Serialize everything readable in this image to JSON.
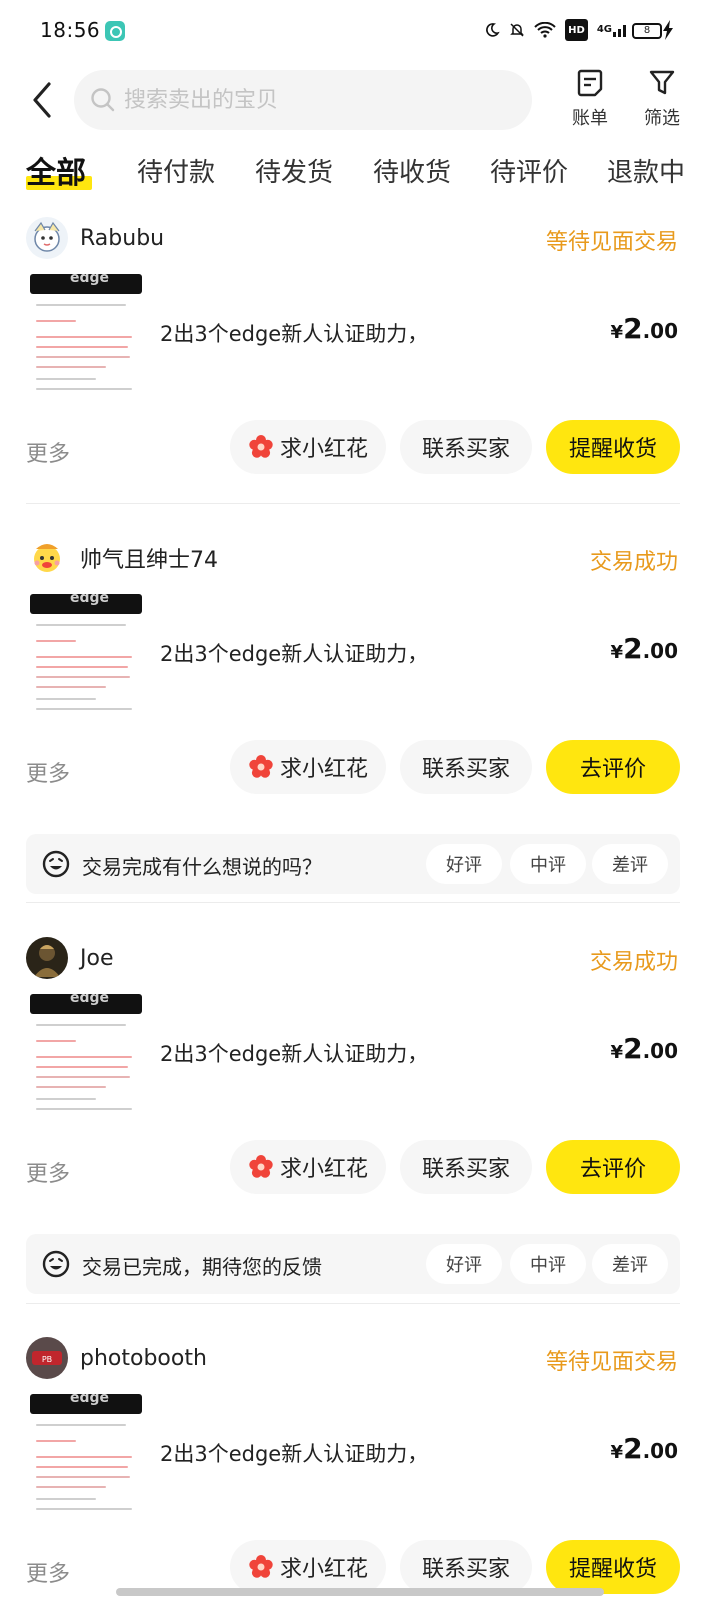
{
  "status_bar": {
    "time": "18:56",
    "battery": "8",
    "network": "4G",
    "hd": "HD"
  },
  "header": {
    "search_placeholder": "搜索卖出的宝贝",
    "bill_label": "账单",
    "filter_label": "筛选"
  },
  "tabs": [
    "全部",
    "待付款",
    "待发货",
    "待收货",
    "待评价",
    "退款中"
  ],
  "orders": [
    {
      "seller": "Rabubu",
      "status": "等待见面交易",
      "title": "2出3个edge新人认证助力，",
      "price_currency": "¥",
      "price_int": "2",
      "price_dec": ".00",
      "more": "更多",
      "flower_btn": "求小红花",
      "contact_btn": "联系买家",
      "main_btn": "提醒收货"
    },
    {
      "seller": "帅气且绅士74",
      "status": "交易成功",
      "title": "2出3个edge新人认证助力，",
      "price_currency": "¥",
      "price_int": "2",
      "price_dec": ".00",
      "more": "更多",
      "flower_btn": "求小红花",
      "contact_btn": "联系买家",
      "main_btn": "去评价",
      "feedback_text": "交易完成有什么想说的吗？",
      "rate_good": "好评",
      "rate_mid": "中评",
      "rate_bad": "差评"
    },
    {
      "seller": "Joe",
      "status": "交易成功",
      "title": "2出3个edge新人认证助力，",
      "price_currency": "¥",
      "price_int": "2",
      "price_dec": ".00",
      "more": "更多",
      "flower_btn": "求小红花",
      "contact_btn": "联系买家",
      "main_btn": "去评价",
      "feedback_text": "交易已完成，期待您的反馈",
      "rate_good": "好评",
      "rate_mid": "中评",
      "rate_bad": "差评"
    },
    {
      "seller": "photobooth",
      "status": "等待见面交易",
      "title": "2出3个edge新人认证助力，",
      "price_currency": "¥",
      "price_int": "2",
      "price_dec": ".00",
      "more": "更多",
      "flower_btn": "求小红花",
      "contact_btn": "联系买家",
      "main_btn": "提醒收货"
    }
  ],
  "thumbnail_text": "edge",
  "colors": {
    "accent_yellow": "#ffe60f",
    "status_orange": "#e89a1c",
    "flower_red": "#f0443a"
  }
}
